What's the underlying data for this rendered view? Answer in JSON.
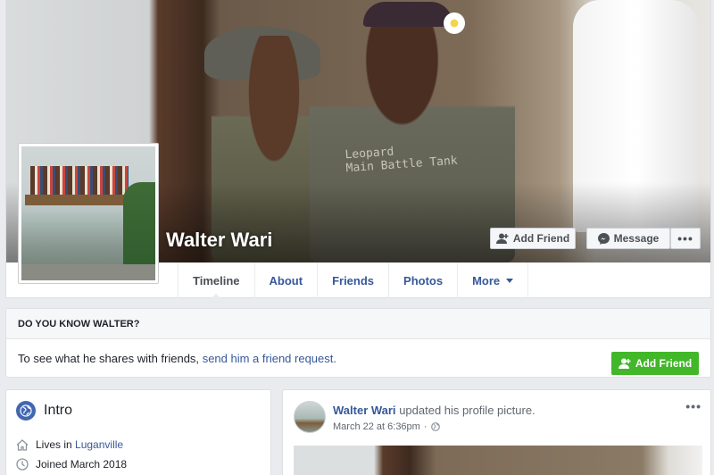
{
  "profile": {
    "name": "Walter Wari",
    "cover_shirt_text": [
      "Leopard",
      "Main Battle Tank"
    ]
  },
  "actions": {
    "add_friend": "Add Friend",
    "message": "Message",
    "more": "•••"
  },
  "nav": {
    "tabs": [
      {
        "label": "Timeline"
      },
      {
        "label": "About"
      },
      {
        "label": "Friends"
      },
      {
        "label": "Photos"
      },
      {
        "label": "More"
      }
    ]
  },
  "know": {
    "heading": "DO YOU KNOW WALTER?",
    "text": "To see what he shares with friends,",
    "link": "send him a friend request.",
    "button": "Add Friend"
  },
  "intro": {
    "title": "Intro",
    "lives_prefix": "Lives in",
    "lives_place": "Luganville",
    "joined": "Joined March 2018"
  },
  "post": {
    "author": "Walter Wari",
    "action": "updated his profile picture.",
    "date": "March 22 at 6:36pm",
    "separator": "·",
    "menu": "•••"
  },
  "colors": {
    "link": "#365899",
    "green": "#42b72a",
    "background": "#e9ebee"
  }
}
